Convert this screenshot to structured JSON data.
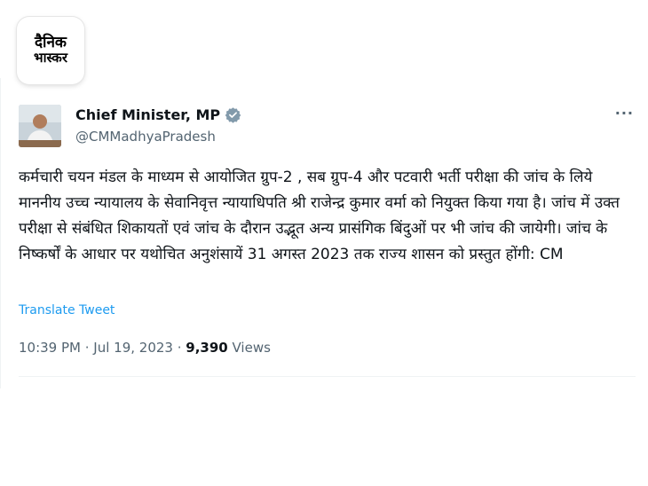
{
  "brand": {
    "logo_line1": "दैनिक",
    "logo_line2": "भास्कर"
  },
  "author": {
    "name": "Chief Minister, MP",
    "handle": "@CMMadhyaPradesh"
  },
  "tweet": {
    "text": "कर्मचारी चयन मंडल के माध्यम से आयोजित ग्रुप-2 , सब ग्रुप-4 और पटवारी भर्ती परीक्षा की जांच के लिये माननीय उच्च न्यायालय के सेवानिवृत्त न्यायाधिपति श्री राजेन्द्र कुमार वर्मा को नियुक्त किया गया है। जांच में उक्त परीक्षा से संबंधित शिकायतों एवं जांच के दौरान उद्भूत अन्य प्रासंगिक बिंदुओं पर भी जांच की जायेगी। जांच के निष्कर्षों के आधार पर यथोचित अनुशंसायें 31 अगस्त 2023 तक राज्य शासन को प्रस्तुत होंगी: CM",
    "translate_label": "Translate Tweet",
    "time": "10:39 PM",
    "separator": " · ",
    "date": "Jul 19, 2023",
    "views_count": "9,390",
    "views_label": " Views"
  },
  "icons": {
    "verified": "verified-badge-icon",
    "more": "more-options-icon"
  },
  "colors": {
    "link": "#1d9bf0",
    "muted": "#536471",
    "verified_badge": "#829aab"
  }
}
